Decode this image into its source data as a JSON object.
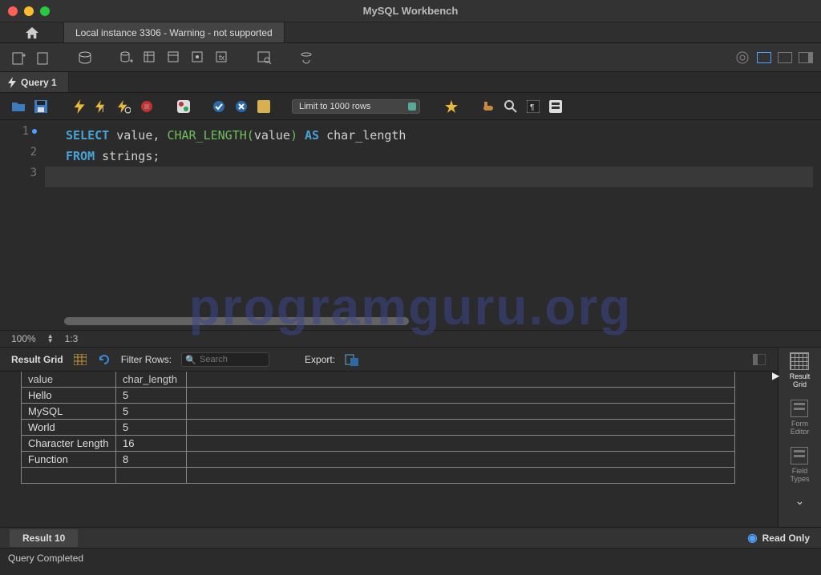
{
  "window": {
    "title": "MySQL Workbench"
  },
  "connection_tab": "Local instance 3306 - Warning - not supported",
  "query_tab": "Query 1",
  "limit_selector": "Limit to 1000 rows",
  "sql": {
    "line1": {
      "select": "SELECT",
      "value1": "value",
      "comma": ",",
      "fn": "CHAR_LENGTH",
      "open": "(",
      "value2": "value",
      "close": ")",
      "as": "AS",
      "alias": "char_length"
    },
    "line2": {
      "from": "FROM",
      "tbl": "strings",
      "semi": ";"
    }
  },
  "zoom": {
    "pct": "100%",
    "pos": "1:3"
  },
  "result_toolbar": {
    "label": "Result Grid",
    "filter_label": "Filter Rows:",
    "search_placeholder": "Search",
    "export_label": "Export:"
  },
  "columns": [
    "value",
    "char_length"
  ],
  "rows": [
    {
      "value": "Hello",
      "char_length": "5"
    },
    {
      "value": "MySQL",
      "char_length": "5"
    },
    {
      "value": "World",
      "char_length": "5"
    },
    {
      "value": "Character Length",
      "char_length": "16"
    },
    {
      "value": "Function",
      "char_length": "8"
    }
  ],
  "side": {
    "grid": "Result\nGrid",
    "form": "Form\nEditor",
    "types": "Field\nTypes"
  },
  "result_footer": {
    "tab": "Result 10",
    "readonly": "Read Only"
  },
  "status": "Query Completed",
  "watermark": "programguru.org"
}
